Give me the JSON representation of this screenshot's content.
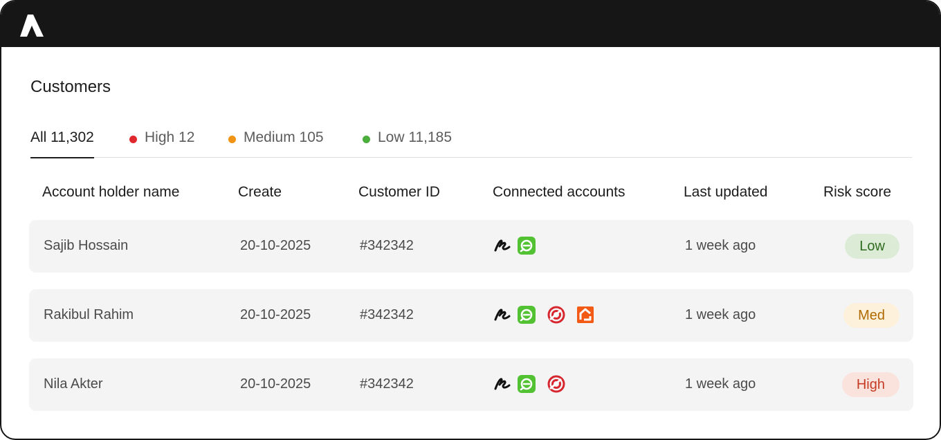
{
  "page": {
    "title": "Customers"
  },
  "tabs": [
    {
      "label": "All 11,302",
      "active": true,
      "dot_color": ""
    },
    {
      "label": "High 12",
      "active": false,
      "dot_color": "#e0272d"
    },
    {
      "label": "Medium 105",
      "active": false,
      "dot_color": "#f29413"
    },
    {
      "label": "Low 11,185",
      "active": false,
      "dot_color": "#4cae3c"
    }
  ],
  "table": {
    "columns": [
      "Account holder name",
      "Create",
      "Customer ID",
      "Connected accounts",
      "Last updated",
      "Risk score"
    ],
    "rows": [
      {
        "name": "Sajib Hossain",
        "created": "20-10-2025",
        "customer_id": "#342342",
        "accounts": [
          "script-r-icon",
          "green-swirl-icon"
        ],
        "last_updated": "1 week ago",
        "risk": "Low"
      },
      {
        "name": "Rakibul Rahim",
        "created": "20-10-2025",
        "customer_id": "#342342",
        "accounts": [
          "script-r-icon",
          "green-swirl-icon",
          "red-target-icon",
          "orange-house-icon"
        ],
        "last_updated": "1 week ago",
        "risk": "Med"
      },
      {
        "name": "Nila Akter",
        "created": "20-10-2025",
        "customer_id": "#342342",
        "accounts": [
          "script-r-icon",
          "green-swirl-icon",
          "red-target-icon"
        ],
        "last_updated": "1 week ago",
        "risk": "High"
      }
    ]
  },
  "risk_styles": {
    "Low": {
      "bg": "#dcebd6",
      "fg": "#2f6b1f"
    },
    "Med": {
      "bg": "#fdf1dc",
      "fg": "#b06a00"
    },
    "High": {
      "bg": "#fbe3dd",
      "fg": "#c43c25"
    }
  },
  "colors": {
    "topbar": "#161616",
    "row_bg": "#f4f4f5",
    "green_brand": "#52c233",
    "red_brand": "#d8262f",
    "orange_brand": "#f25a16"
  }
}
